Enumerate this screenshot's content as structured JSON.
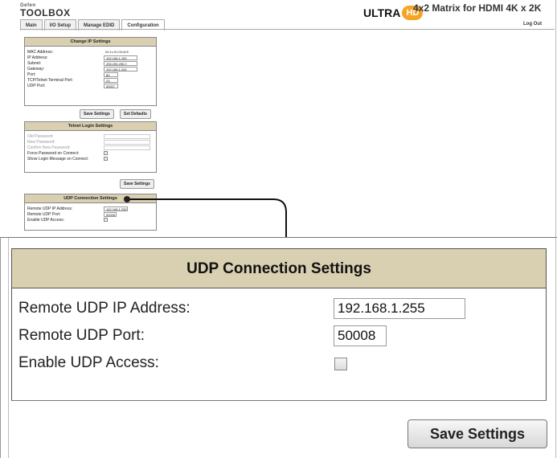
{
  "header": {
    "brand_pre": "Gefen",
    "brand": "TOOLBOX",
    "logo_text": "ULTRA",
    "logo_badge": "HD",
    "product_title": "4x2 Matrix for HDMI 4K x 2K",
    "logout": "Log Out"
  },
  "tabs": [
    {
      "label": "Main"
    },
    {
      "label": "I/O Setup"
    },
    {
      "label": "Manage EDID"
    },
    {
      "label": "Configuration"
    }
  ],
  "ip_settings": {
    "title": "Change IP Settings",
    "rows": [
      {
        "label": "MAC Address:",
        "value": "00:1c:91:03:4f:ff"
      },
      {
        "label": "IP Address:",
        "value": "192.168.1.150"
      },
      {
        "label": "Subnet:",
        "value": "255.255.255.0"
      },
      {
        "label": "Gateway:",
        "value": "192.168.1.254"
      },
      {
        "label": "Port:",
        "value": "80"
      },
      {
        "label": "TCP/Telnet Terminal Port:",
        "value": "23"
      },
      {
        "label": "UDP Port:",
        "value": "50007"
      }
    ],
    "save_label": "Save Settings",
    "defaults_label": "Set Defaults"
  },
  "telnet_settings": {
    "title": "Telnet Login Settings",
    "rows": [
      {
        "label": "Old Password:"
      },
      {
        "label": "New Password:"
      },
      {
        "label": "Confirm New Password:"
      },
      {
        "label": "Force Password on Connect:"
      },
      {
        "label": "Show Login Message on Connect:"
      }
    ],
    "save_label": "Save Settings"
  },
  "udp_settings": {
    "title": "UDP Connection Settings",
    "remote_ip_label": "Remote UDP IP Address:",
    "remote_ip_value": "192.168.1.255",
    "remote_port_label": "Remote UDP Port:",
    "remote_port_value": "50008",
    "enable_label": "Enable UDP Access:",
    "enable_checked": false,
    "save_label": "Save Settings"
  },
  "colors": {
    "panel_header": "#d9cfb1",
    "logo_badge": "#f5a524"
  }
}
